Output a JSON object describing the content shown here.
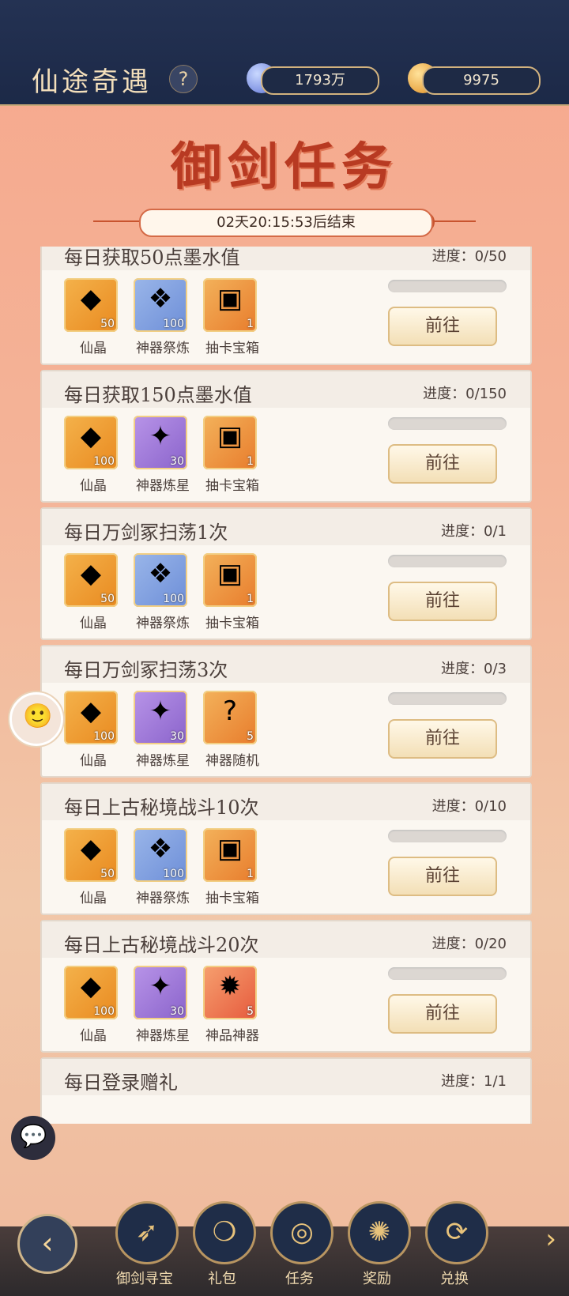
{
  "top": {
    "title": "仙途奇遇",
    "help": "?",
    "currency1": "1793万",
    "currency2": "9975"
  },
  "banner": {
    "title": "御剑任务",
    "timer": "02天20:15:53后结束"
  },
  "tasks": [
    {
      "title": "每日获取50点墨水值",
      "progress": "进度：0/50",
      "progress_value": 0,
      "rewards": [
        {
          "name": "仙晶",
          "qty": "50",
          "icon": "crystal-icon",
          "color": "gold"
        },
        {
          "name": "神器祭炼",
          "qty": "100",
          "icon": "ore-icon",
          "color": "blue"
        },
        {
          "name": "抽卡宝箱",
          "qty": "1",
          "icon": "chest-icon",
          "color": "orange"
        }
      ],
      "button": "前往"
    },
    {
      "title": "每日获取150点墨水值",
      "progress": "进度：0/150",
      "progress_value": 0,
      "rewards": [
        {
          "name": "仙晶",
          "qty": "100",
          "icon": "crystal-icon",
          "color": "gold"
        },
        {
          "name": "神器炼星",
          "qty": "30",
          "icon": "star-icon",
          "color": "purple"
        },
        {
          "name": "抽卡宝箱",
          "qty": "1",
          "icon": "chest-icon",
          "color": "orange"
        }
      ],
      "button": "前往"
    },
    {
      "title": "每日万剑冢扫荡1次",
      "progress": "进度：0/1",
      "progress_value": 0,
      "rewards": [
        {
          "name": "仙晶",
          "qty": "50",
          "icon": "crystal-icon",
          "color": "gold"
        },
        {
          "name": "神器祭炼",
          "qty": "100",
          "icon": "ore-icon",
          "color": "blue"
        },
        {
          "name": "抽卡宝箱",
          "qty": "1",
          "icon": "chest-icon",
          "color": "orange"
        }
      ],
      "button": "前往"
    },
    {
      "title": "每日万剑冢扫荡3次",
      "progress": "进度：0/3",
      "progress_value": 0,
      "rewards": [
        {
          "name": "仙晶",
          "qty": "100",
          "icon": "crystal-icon",
          "color": "gold"
        },
        {
          "name": "神器炼星",
          "qty": "30",
          "icon": "star-icon",
          "color": "purple"
        },
        {
          "name": "神器随机",
          "qty": "5",
          "icon": "mystery-icon",
          "color": "orange"
        }
      ],
      "button": "前往"
    },
    {
      "title": "每日上古秘境战斗10次",
      "progress": "进度：0/10",
      "progress_value": 0,
      "rewards": [
        {
          "name": "仙晶",
          "qty": "50",
          "icon": "crystal-icon",
          "color": "gold"
        },
        {
          "name": "神器祭炼",
          "qty": "100",
          "icon": "ore-icon",
          "color": "blue"
        },
        {
          "name": "抽卡宝箱",
          "qty": "1",
          "icon": "chest-icon",
          "color": "orange"
        }
      ],
      "button": "前往"
    },
    {
      "title": "每日上古秘境战斗20次",
      "progress": "进度：0/20",
      "progress_value": 0,
      "rewards": [
        {
          "name": "仙晶",
          "qty": "100",
          "icon": "crystal-icon",
          "color": "gold"
        },
        {
          "name": "神器炼星",
          "qty": "30",
          "icon": "star-icon",
          "color": "purple"
        },
        {
          "name": "神品神器",
          "qty": "5",
          "icon": "artifact-icon",
          "color": "red"
        }
      ],
      "button": "前往"
    },
    {
      "title": "每日登录赠礼",
      "progress": "进度：1/1",
      "progress_value": 1,
      "rewards": [],
      "button": ""
    }
  ],
  "bottom_nav": [
    {
      "label": "御剑寻宝",
      "icon": "bow-icon"
    },
    {
      "label": "礼包",
      "icon": "gift-icon"
    },
    {
      "label": "任务",
      "icon": "task-icon"
    },
    {
      "label": "奖励",
      "icon": "flame-icon"
    },
    {
      "label": "兑换",
      "icon": "exchange-icon"
    }
  ]
}
